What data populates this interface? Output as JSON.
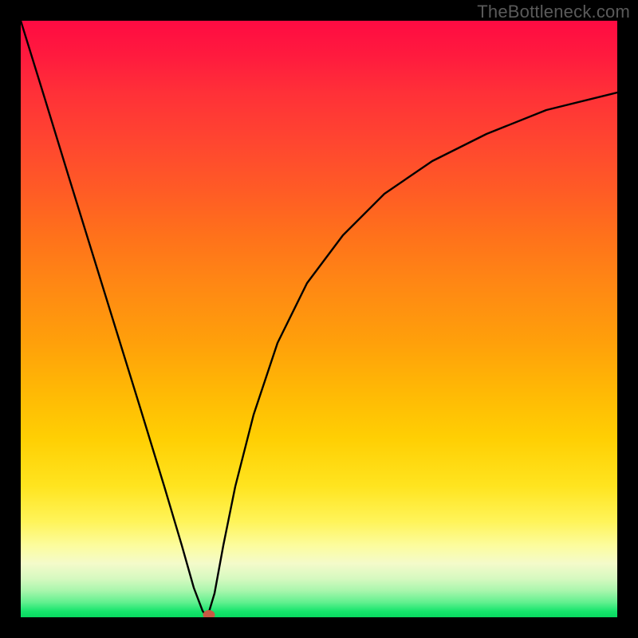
{
  "watermark": "TheBottleneck.com",
  "chart_data": {
    "type": "line",
    "title": "",
    "xlabel": "",
    "ylabel": "",
    "xlim": [
      0,
      100
    ],
    "ylim": [
      0,
      100
    ],
    "grid": false,
    "legend": false,
    "series": [
      {
        "name": "left-branch",
        "x": [
          0,
          4,
          8,
          12,
          16,
          20,
          24,
          27,
          29,
          30.5,
          31.3
        ],
        "y": [
          100,
          87,
          74,
          61,
          48,
          35,
          22,
          12,
          5,
          1,
          0
        ]
      },
      {
        "name": "right-branch",
        "x": [
          31.3,
          32.5,
          34,
          36,
          39,
          43,
          48,
          54,
          61,
          69,
          78,
          88,
          100
        ],
        "y": [
          0,
          4,
          12,
          22,
          34,
          46,
          56,
          64,
          71,
          76.5,
          81,
          85,
          88
        ]
      }
    ],
    "minimum_point": {
      "x": 31.3,
      "y": 0
    },
    "colors": {
      "curve": "#000000",
      "min_dot": "#c85a44",
      "gradient_top": "#ff0b42",
      "gradient_bottom": "#08d95f"
    }
  }
}
